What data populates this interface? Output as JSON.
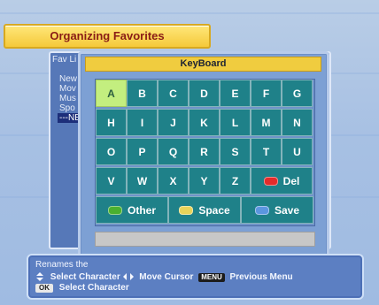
{
  "title": "Organizing Favorites",
  "favorites": {
    "header": "Fav Li",
    "items": [
      "New",
      "Mov",
      "Mus",
      "Spo",
      "---NEV"
    ]
  },
  "keyboard": {
    "title": "KeyBoard",
    "rows": [
      [
        "A",
        "B",
        "C",
        "D",
        "E",
        "F",
        "G"
      ],
      [
        "H",
        "I",
        "J",
        "K",
        "L",
        "M",
        "N"
      ],
      [
        "O",
        "P",
        "Q",
        "R",
        "S",
        "T",
        "U"
      ],
      [
        "V",
        "W",
        "X",
        "Y",
        "Z"
      ]
    ],
    "del_label": "Del",
    "other_label": "Other",
    "space_label": "Space",
    "save_label": "Save",
    "selected_key": "A"
  },
  "help": {
    "top_text": "Renames the",
    "line1_a": "Select Character",
    "line1_b": "Move Cursor",
    "line1_menu": "MENU",
    "line1_c": "Previous Menu",
    "line2_ok": "OK",
    "line2_text": "Select Character"
  },
  "colors": {
    "key": "#1f8189",
    "selected_key": "#c3ee7f",
    "title_bar": "#f0cc3f"
  }
}
